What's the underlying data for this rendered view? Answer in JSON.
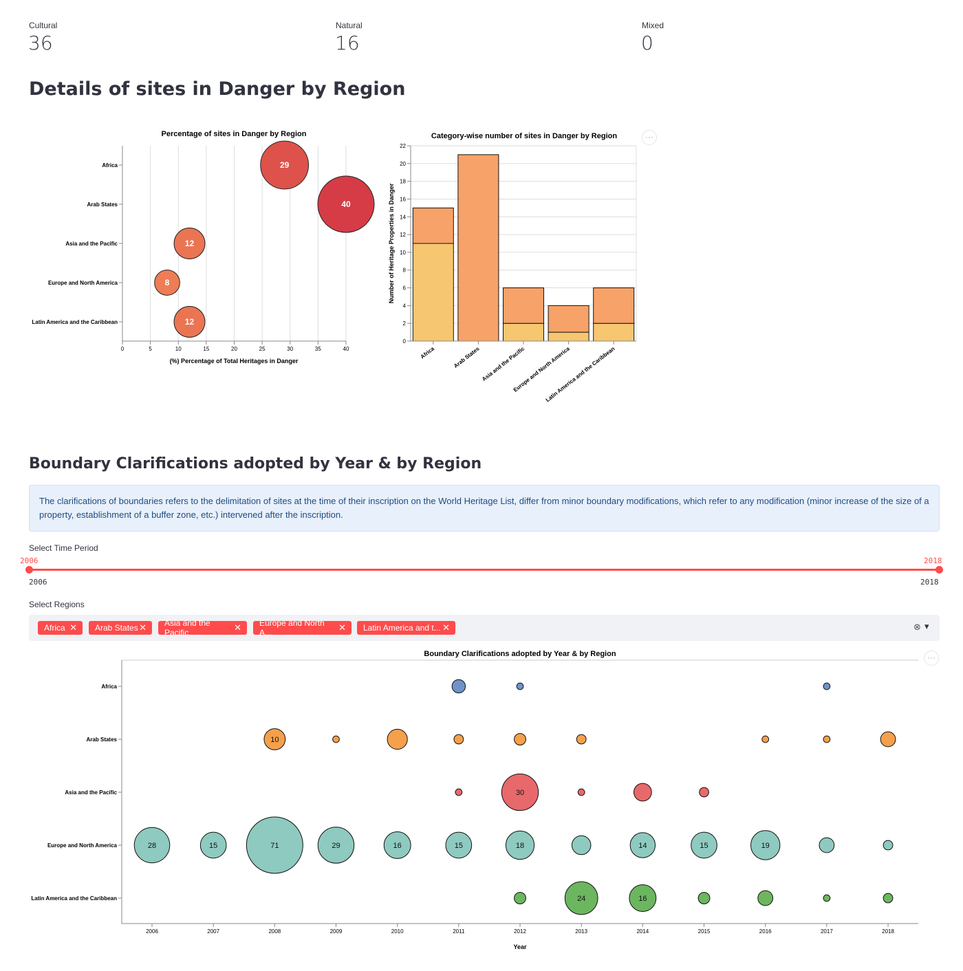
{
  "metrics": [
    {
      "label": "Cultural",
      "value": "36"
    },
    {
      "label": "Natural",
      "value": "16"
    },
    {
      "label": "Mixed",
      "value": "0"
    }
  ],
  "sections": {
    "danger_title": "Details of sites in Danger by Region",
    "boundary_title": "Boundary Clarifications adopted by Year & by Region"
  },
  "info_text": "The clarifications of boundaries refers to the delimitation of sites at the time of their inscription on the World Heritage List, differ from minor boundary modifications, which refer to any modification (minor increase of the size of a property, establishment of a buffer zone, etc.) intervened after the inscription.",
  "time_slider": {
    "label": "Select Time Period",
    "value_start": "2006",
    "value_end": "2018",
    "min_label": "2006",
    "max_label": "2018"
  },
  "region_select": {
    "label": "Select Regions",
    "tags": [
      "Africa",
      "Arab States",
      "Asia and the Pacific",
      "Europe and North A...",
      "Latin America and t..."
    ],
    "remove_glyph": "✕",
    "clear_glyph": "⊗",
    "open_glyph": "▾"
  },
  "menu_glyph": "···",
  "colors": {
    "accent": "#ff4b4b",
    "natural_bar": "#f7c670",
    "cultural_bar": "#f7a268",
    "africa": "#6f93c8",
    "arab_states": "#f5a04b",
    "asia_pacific": "#e8696b",
    "europe_na": "#8ecabf",
    "latin_america": "#6cb65f"
  },
  "chart_data": [
    {
      "type": "scatter",
      "title": "Percentage of sites in Danger by Region",
      "xlabel": "(%) Percentage of Total Heritages in Danger",
      "ylabel": "",
      "xlim": [
        0,
        40
      ],
      "xticks": [
        "0",
        "5",
        "10",
        "15",
        "20",
        "25",
        "30",
        "35",
        "40"
      ],
      "categories": [
        "Africa",
        "Arab States",
        "Asia and the Pacific",
        "Europe and North America",
        "Latin America and the Caribbean"
      ],
      "values": [
        29,
        40,
        12,
        8,
        12
      ],
      "data_labels": [
        "29",
        "40",
        "12",
        "8",
        "12"
      ],
      "grid": true
    },
    {
      "type": "bar",
      "title": "Category-wise number of sites in Danger by Region",
      "xlabel": "",
      "ylabel": "Number of Heritage Properties in Danger",
      "ylim": [
        0,
        22
      ],
      "yticks": [
        "0",
        "2",
        "4",
        "6",
        "8",
        "10",
        "12",
        "14",
        "16",
        "18",
        "20",
        "22"
      ],
      "categories": [
        "Africa",
        "Arab States",
        "Asia and the Pacific",
        "Europe and North America",
        "Latin America and the Caribbean"
      ],
      "stacked": true,
      "series": [
        {
          "values": [
            11,
            0,
            2,
            1,
            2
          ]
        },
        {
          "values": [
            4,
            21,
            4,
            3,
            4
          ]
        }
      ],
      "grid": true
    },
    {
      "type": "scatter",
      "title": "Boundary Clarifications adopted by Year & by Region",
      "xlabel": "Year",
      "ylabel": "",
      "x": [
        "2006",
        "2007",
        "2008",
        "2009",
        "2010",
        "2011",
        "2012",
        "2013",
        "2014",
        "2015",
        "2016",
        "2017",
        "2018"
      ],
      "categories": [
        "Africa",
        "Arab States",
        "Asia and the Pacific",
        "Europe and North America",
        "Latin America and the Caribbean"
      ],
      "series": [
        {
          "region": "Africa",
          "points": [
            {
              "x": "2011",
              "size": 4
            },
            {
              "x": "2012",
              "size": 1
            },
            {
              "x": "2017",
              "size": 1
            }
          ]
        },
        {
          "region": "Arab States",
          "points": [
            {
              "x": "2008",
              "size": 10,
              "label": "10"
            },
            {
              "x": "2009",
              "size": 1
            },
            {
              "x": "2010",
              "size": 9
            },
            {
              "x": "2011",
              "size": 2
            },
            {
              "x": "2012",
              "size": 3
            },
            {
              "x": "2013",
              "size": 2
            },
            {
              "x": "2016",
              "size": 1
            },
            {
              "x": "2017",
              "size": 1
            },
            {
              "x": "2018",
              "size": 5
            }
          ]
        },
        {
          "region": "Asia and the Pacific",
          "points": [
            {
              "x": "2011",
              "size": 1
            },
            {
              "x": "2012",
              "size": 30,
              "label": "30"
            },
            {
              "x": "2013",
              "size": 1
            },
            {
              "x": "2014",
              "size": 7
            },
            {
              "x": "2015",
              "size": 2
            }
          ]
        },
        {
          "region": "Europe and North America",
          "points": [
            {
              "x": "2006",
              "size": 28,
              "label": "28"
            },
            {
              "x": "2007",
              "size": 15,
              "label": "15"
            },
            {
              "x": "2008",
              "size": 71,
              "label": "71"
            },
            {
              "x": "2009",
              "size": 29,
              "label": "29"
            },
            {
              "x": "2010",
              "size": 16,
              "label": "16"
            },
            {
              "x": "2011",
              "size": 15,
              "label": "15"
            },
            {
              "x": "2012",
              "size": 18,
              "label": "18"
            },
            {
              "x": "2013",
              "size": 8
            },
            {
              "x": "2014",
              "size": 14,
              "label": "14"
            },
            {
              "x": "2015",
              "size": 15,
              "label": "15"
            },
            {
              "x": "2016",
              "size": 19,
              "label": "19"
            },
            {
              "x": "2017",
              "size": 5
            },
            {
              "x": "2018",
              "size": 2
            }
          ]
        },
        {
          "region": "Latin America and the Caribbean",
          "points": [
            {
              "x": "2012",
              "size": 3
            },
            {
              "x": "2013",
              "size": 24,
              "label": "24"
            },
            {
              "x": "2014",
              "size": 16,
              "label": "16"
            },
            {
              "x": "2015",
              "size": 3
            },
            {
              "x": "2016",
              "size": 5
            },
            {
              "x": "2017",
              "size": 1
            },
            {
              "x": "2018",
              "size": 2
            }
          ]
        }
      ],
      "grid": false
    }
  ]
}
